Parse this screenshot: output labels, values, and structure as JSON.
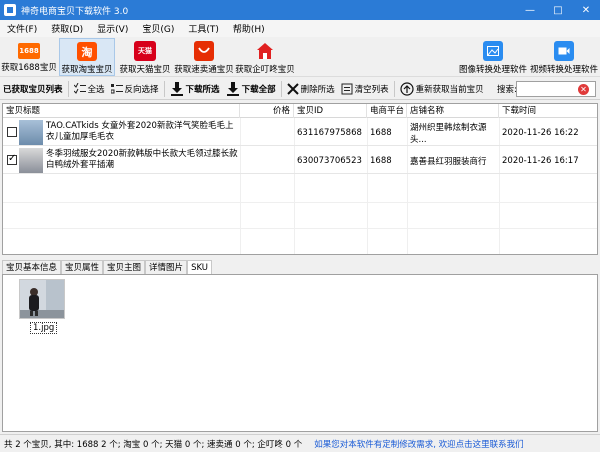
{
  "window": {
    "title": "神奇电商宝贝下载软件 3.0"
  },
  "menu": [
    "文件(F)",
    "获取(D)",
    "显示(V)",
    "宝贝(G)",
    "工具(T)",
    "帮助(H)"
  ],
  "big_toolbar": {
    "left": [
      {
        "label": "获取1688宝贝",
        "icon": "1688-icon",
        "icon_text": "1688",
        "color": "#ff6a00"
      },
      {
        "label": "获取淘宝宝贝",
        "icon": "taobao-icon",
        "icon_text": "淘",
        "color": "#ff5000"
      },
      {
        "label": "获取天猫宝贝",
        "icon": "tmall-icon",
        "icon_text": "天猫",
        "color": "#d7001b"
      },
      {
        "label": "获取速卖通宝贝",
        "icon": "aliexpress-icon",
        "icon_text": "",
        "color": "#e62e04"
      },
      {
        "label": "获取企叮咚宝贝",
        "icon": "home-icon",
        "icon_text": "",
        "color": "#e02020"
      }
    ],
    "right": [
      {
        "label": "图像转换处理软件",
        "icon": "image-convert-icon",
        "color": "#2a8cf0"
      },
      {
        "label": "视频转换处理软件",
        "icon": "video-convert-icon",
        "color": "#2a8cf0"
      }
    ]
  },
  "small_toolbar": {
    "list_label": "已获取宝贝列表",
    "select_all": "全选",
    "invert": "反向选择",
    "download_selected": "下载所选",
    "download_all": "下载全部",
    "delete_selected": "删除所选",
    "clear_list": "清空列表",
    "refetch": "重新获取当前宝贝",
    "search_label": "搜索:",
    "search_value": ""
  },
  "table": {
    "headers": [
      "宝贝标题",
      "价格",
      "宝贝ID",
      "电商平台",
      "店铺名称",
      "下载时间"
    ],
    "rows": [
      {
        "checked": false,
        "title": "TAO.CATkids 女童外套2020新款洋气笑脸毛毛上衣儿童加厚毛毛衣",
        "price": "",
        "id": "631167975868",
        "platform": "1688",
        "shop": "湖州织里韩炫制衣源头...",
        "time": "2020-11-26 16:22"
      },
      {
        "checked": true,
        "title": "冬季羽绒服女2020新款韩版中长款大毛领过膝长款白鸭绒外套平插潮",
        "price": "",
        "id": "630073706523",
        "platform": "1688",
        "shop": "嘉善县红羽服装商行",
        "time": "2020-11-26 16:17"
      }
    ]
  },
  "tabs": [
    "宝贝基本信息",
    "宝贝属性",
    "宝贝主图",
    "详情图片",
    "SKU"
  ],
  "active_tab": "SKU",
  "sku_images": [
    {
      "filename": "1.jpg"
    }
  ],
  "status": {
    "summary": "共 2 个宝贝, 其中: 1688 2 个; 淘宝 0 个; 天猫 0 个; 速卖通 0 个; 企叮咚 0 个",
    "link": "如果您对本软件有定制修改需求, 欢迎点击这里联系我们"
  }
}
